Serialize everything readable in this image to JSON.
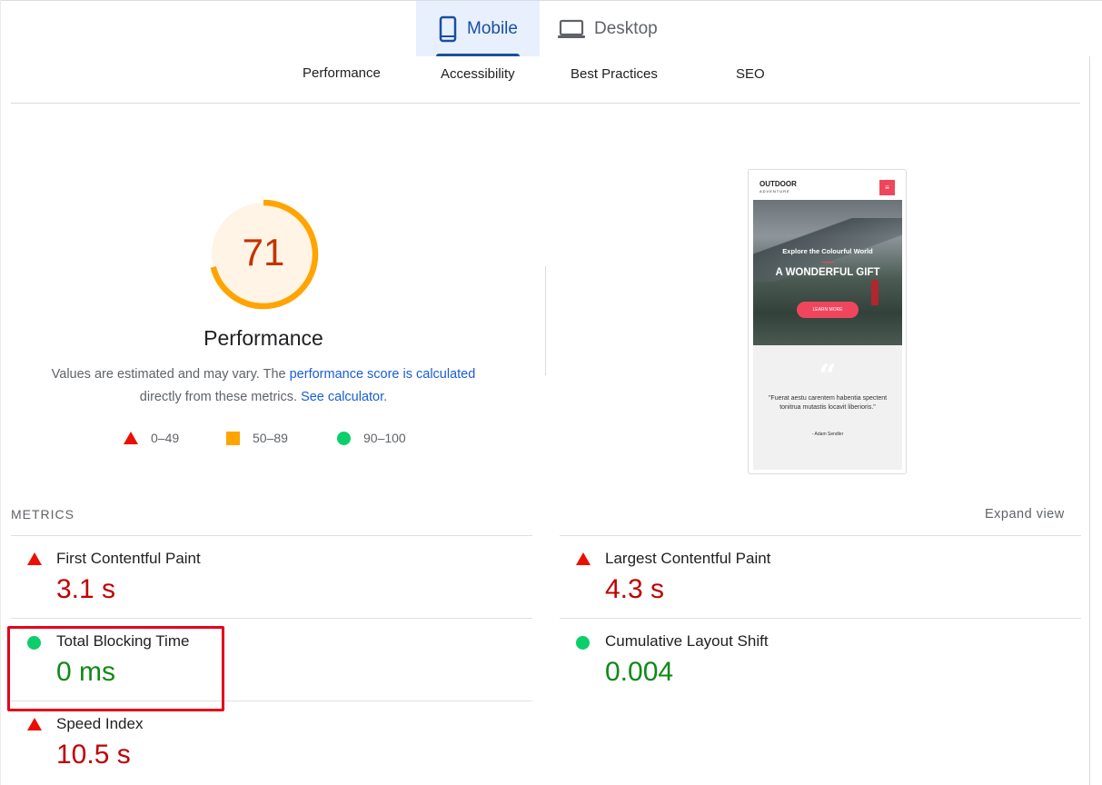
{
  "device_tabs": {
    "mobile": "Mobile",
    "desktop": "Desktop"
  },
  "category_tabs": [
    "Performance",
    "Accessibility",
    "Best Practices",
    "SEO"
  ],
  "score": {
    "value": "71",
    "gauge_fraction": 0.71,
    "title": "Performance"
  },
  "description": {
    "prefix": "Values are estimated and may vary. The ",
    "link1": "performance score is calculated",
    "middle": "directly from these metrics. ",
    "link2": "See calculator",
    "suffix": "."
  },
  "legend": {
    "fail": "0–49",
    "average": "50–89",
    "pass": "90–100"
  },
  "thumbnail": {
    "logo": "OUTDOOR",
    "logo_sub": "ADVENTURE",
    "menu_icon": "≡",
    "subtitle": "Explore the Colourful World",
    "title": "A WONDERFUL GIFT",
    "button": "LEARN MORE",
    "quote_mark": "“",
    "quote": "\"Fuerat aestu carentem habentia spectent tonitrua mutastis locavit liberioris.\"",
    "author": "- Adam Sendler"
  },
  "metrics": {
    "label": "METRICS",
    "expand": "Expand view",
    "fcp": {
      "name": "First Contentful Paint",
      "value": "3.1 s",
      "status": "fail"
    },
    "lcp": {
      "name": "Largest Contentful Paint",
      "value": "4.3 s",
      "status": "fail"
    },
    "tbt": {
      "name": "Total Blocking Time",
      "value": "0 ms",
      "status": "pass"
    },
    "cls": {
      "name": "Cumulative Layout Shift",
      "value": "0.004",
      "status": "pass"
    },
    "si": {
      "name": "Speed Index",
      "value": "10.5 s",
      "status": "fail"
    }
  },
  "colors": {
    "fail": "#eb0f00",
    "average": "#ffa400",
    "pass": "#0cce6b",
    "accent": "#1a4fa0",
    "highlight": "#e4001a"
  }
}
